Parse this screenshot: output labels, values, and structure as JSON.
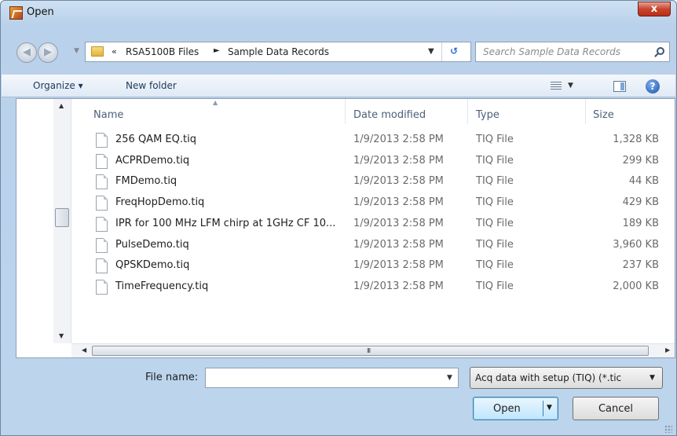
{
  "window": {
    "title": "Open",
    "close_label": "x"
  },
  "address": {
    "chevron": "«",
    "crumbs": [
      "RSA5100B Files",
      "Sample Data Records"
    ],
    "separator": "►",
    "search_placeholder": "Search Sample Data Records"
  },
  "toolbar": {
    "organize": "Organize ▾",
    "new_folder": "New folder",
    "help": "?"
  },
  "columns": {
    "name": "Name",
    "date": "Date modified",
    "type": "Type",
    "size": "Size"
  },
  "files": [
    {
      "name": "256 QAM EQ.tiq",
      "date": "1/9/2013 2:58 PM",
      "type": "TIQ File",
      "size": "1,328 KB"
    },
    {
      "name": "ACPRDemo.tiq",
      "date": "1/9/2013 2:58 PM",
      "type": "TIQ File",
      "size": "299 KB"
    },
    {
      "name": "FMDemo.tiq",
      "date": "1/9/2013 2:58 PM",
      "type": "TIQ File",
      "size": "44 KB"
    },
    {
      "name": "FreqHopDemo.tiq",
      "date": "1/9/2013 2:58 PM",
      "type": "TIQ File",
      "size": "429 KB"
    },
    {
      "name": "IPR for 100 MHz LFM chirp at 1GHz CF 10...",
      "date": "1/9/2013 2:58 PM",
      "type": "TIQ File",
      "size": "189 KB"
    },
    {
      "name": "PulseDemo.tiq",
      "date": "1/9/2013 2:58 PM",
      "type": "TIQ File",
      "size": "3,960 KB"
    },
    {
      "name": "QPSKDemo.tiq",
      "date": "1/9/2013 2:58 PM",
      "type": "TIQ File",
      "size": "237 KB"
    },
    {
      "name": "TimeFrequency.tiq",
      "date": "1/9/2013 2:58 PM",
      "type": "TIQ File",
      "size": "2,000 KB"
    }
  ],
  "bottom": {
    "file_name_label": "File name:",
    "file_name_value": "",
    "filter": "Acq data with setup  (TIQ) (*.tic",
    "open": "Open",
    "cancel": "Cancel"
  },
  "colors": {
    "accent": "#3c7fb1",
    "frame": "#bcd4ec",
    "close": "#c8452f"
  }
}
